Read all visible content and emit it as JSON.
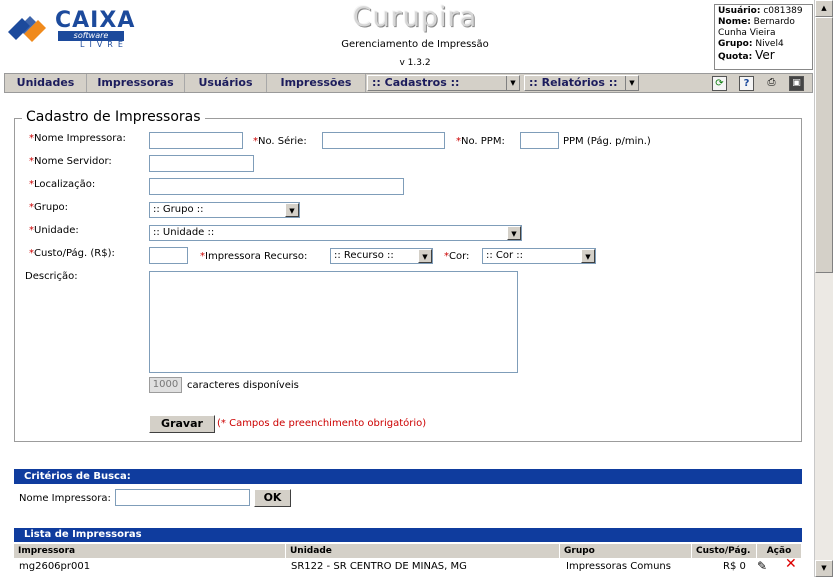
{
  "header": {
    "logo_text": "CAIXA",
    "logo_software": "software",
    "logo_livre": "LIVRE",
    "app_title": "Curupira",
    "app_subtitle": "Gerenciamento de Impressão",
    "version": "v 1.3.2"
  },
  "user": {
    "usuario_label": "Usuário:",
    "usuario_value": "c081389",
    "nome_label": "Nome:",
    "nome_value": "Bernardo",
    "nome_value2": "Cunha Vieira",
    "grupo_label": "Grupo:",
    "grupo_value": "Nivel4",
    "quota_label": "Quota:",
    "quota_value": "Ver"
  },
  "menu": {
    "items": [
      "Unidades",
      "Impressoras",
      "Usuários",
      "Impressões"
    ],
    "cadastros": ":: Cadastros ::",
    "relatorios": ":: Relatórios ::"
  },
  "form": {
    "legend": "Cadastro de Impressoras",
    "req_mark": "*",
    "nome_impressora": "Nome Impressora:",
    "no_serie": "No. Série:",
    "no_ppm": "No. PPM:",
    "ppm_hint": "PPM (Pág. p/min.)",
    "nome_servidor": "Nome Servidor:",
    "localizacao": "Localização:",
    "grupo": "Grupo:",
    "grupo_select": ":: Grupo ::",
    "unidade": "Unidade:",
    "unidade_select": ":: Unidade ::",
    "custo": "Custo/Pág. (R$):",
    "impressora_recurso": "Impressora Recurso:",
    "recurso_select": ":: Recurso ::",
    "cor": "Cor:",
    "cor_select": ":: Cor ::",
    "descricao": "Descrição:",
    "counter_value": "1000",
    "counter_suffix": "caracteres disponíveis",
    "gravar": "Gravar",
    "required_note": "(* Campos de preenchimento obrigatório)"
  },
  "search": {
    "title": "Critérios de Busca:",
    "label": "Nome Impressora:",
    "ok": "OK"
  },
  "list": {
    "title": "Lista de Impressoras",
    "columns": [
      "Impressora",
      "Unidade",
      "Grupo",
      "Custo/Pág.",
      "Ação"
    ],
    "rows": [
      {
        "impressora": "mg2606pr001",
        "unidade": "SR122 - SR CENTRO DE MINAS, MG",
        "grupo": "Impressoras Comuns",
        "custo": "R$ 0"
      }
    ]
  }
}
